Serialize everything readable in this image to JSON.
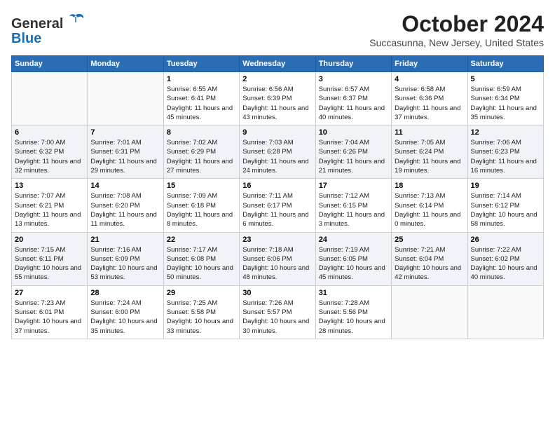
{
  "header": {
    "logo_general": "General",
    "logo_blue": "Blue",
    "month_title": "October 2024",
    "location": "Succasunna, New Jersey, United States"
  },
  "weekdays": [
    "Sunday",
    "Monday",
    "Tuesday",
    "Wednesday",
    "Thursday",
    "Friday",
    "Saturday"
  ],
  "weeks": [
    [
      {
        "day": "",
        "info": ""
      },
      {
        "day": "",
        "info": ""
      },
      {
        "day": "1",
        "info": "Sunrise: 6:55 AM\nSunset: 6:41 PM\nDaylight: 11 hours and 45 minutes."
      },
      {
        "day": "2",
        "info": "Sunrise: 6:56 AM\nSunset: 6:39 PM\nDaylight: 11 hours and 43 minutes."
      },
      {
        "day": "3",
        "info": "Sunrise: 6:57 AM\nSunset: 6:37 PM\nDaylight: 11 hours and 40 minutes."
      },
      {
        "day": "4",
        "info": "Sunrise: 6:58 AM\nSunset: 6:36 PM\nDaylight: 11 hours and 37 minutes."
      },
      {
        "day": "5",
        "info": "Sunrise: 6:59 AM\nSunset: 6:34 PM\nDaylight: 11 hours and 35 minutes."
      }
    ],
    [
      {
        "day": "6",
        "info": "Sunrise: 7:00 AM\nSunset: 6:32 PM\nDaylight: 11 hours and 32 minutes."
      },
      {
        "day": "7",
        "info": "Sunrise: 7:01 AM\nSunset: 6:31 PM\nDaylight: 11 hours and 29 minutes."
      },
      {
        "day": "8",
        "info": "Sunrise: 7:02 AM\nSunset: 6:29 PM\nDaylight: 11 hours and 27 minutes."
      },
      {
        "day": "9",
        "info": "Sunrise: 7:03 AM\nSunset: 6:28 PM\nDaylight: 11 hours and 24 minutes."
      },
      {
        "day": "10",
        "info": "Sunrise: 7:04 AM\nSunset: 6:26 PM\nDaylight: 11 hours and 21 minutes."
      },
      {
        "day": "11",
        "info": "Sunrise: 7:05 AM\nSunset: 6:24 PM\nDaylight: 11 hours and 19 minutes."
      },
      {
        "day": "12",
        "info": "Sunrise: 7:06 AM\nSunset: 6:23 PM\nDaylight: 11 hours and 16 minutes."
      }
    ],
    [
      {
        "day": "13",
        "info": "Sunrise: 7:07 AM\nSunset: 6:21 PM\nDaylight: 11 hours and 13 minutes."
      },
      {
        "day": "14",
        "info": "Sunrise: 7:08 AM\nSunset: 6:20 PM\nDaylight: 11 hours and 11 minutes."
      },
      {
        "day": "15",
        "info": "Sunrise: 7:09 AM\nSunset: 6:18 PM\nDaylight: 11 hours and 8 minutes."
      },
      {
        "day": "16",
        "info": "Sunrise: 7:11 AM\nSunset: 6:17 PM\nDaylight: 11 hours and 6 minutes."
      },
      {
        "day": "17",
        "info": "Sunrise: 7:12 AM\nSunset: 6:15 PM\nDaylight: 11 hours and 3 minutes."
      },
      {
        "day": "18",
        "info": "Sunrise: 7:13 AM\nSunset: 6:14 PM\nDaylight: 11 hours and 0 minutes."
      },
      {
        "day": "19",
        "info": "Sunrise: 7:14 AM\nSunset: 6:12 PM\nDaylight: 10 hours and 58 minutes."
      }
    ],
    [
      {
        "day": "20",
        "info": "Sunrise: 7:15 AM\nSunset: 6:11 PM\nDaylight: 10 hours and 55 minutes."
      },
      {
        "day": "21",
        "info": "Sunrise: 7:16 AM\nSunset: 6:09 PM\nDaylight: 10 hours and 53 minutes."
      },
      {
        "day": "22",
        "info": "Sunrise: 7:17 AM\nSunset: 6:08 PM\nDaylight: 10 hours and 50 minutes."
      },
      {
        "day": "23",
        "info": "Sunrise: 7:18 AM\nSunset: 6:06 PM\nDaylight: 10 hours and 48 minutes."
      },
      {
        "day": "24",
        "info": "Sunrise: 7:19 AM\nSunset: 6:05 PM\nDaylight: 10 hours and 45 minutes."
      },
      {
        "day": "25",
        "info": "Sunrise: 7:21 AM\nSunset: 6:04 PM\nDaylight: 10 hours and 42 minutes."
      },
      {
        "day": "26",
        "info": "Sunrise: 7:22 AM\nSunset: 6:02 PM\nDaylight: 10 hours and 40 minutes."
      }
    ],
    [
      {
        "day": "27",
        "info": "Sunrise: 7:23 AM\nSunset: 6:01 PM\nDaylight: 10 hours and 37 minutes."
      },
      {
        "day": "28",
        "info": "Sunrise: 7:24 AM\nSunset: 6:00 PM\nDaylight: 10 hours and 35 minutes."
      },
      {
        "day": "29",
        "info": "Sunrise: 7:25 AM\nSunset: 5:58 PM\nDaylight: 10 hours and 33 minutes."
      },
      {
        "day": "30",
        "info": "Sunrise: 7:26 AM\nSunset: 5:57 PM\nDaylight: 10 hours and 30 minutes."
      },
      {
        "day": "31",
        "info": "Sunrise: 7:28 AM\nSunset: 5:56 PM\nDaylight: 10 hours and 28 minutes."
      },
      {
        "day": "",
        "info": ""
      },
      {
        "day": "",
        "info": ""
      }
    ]
  ]
}
